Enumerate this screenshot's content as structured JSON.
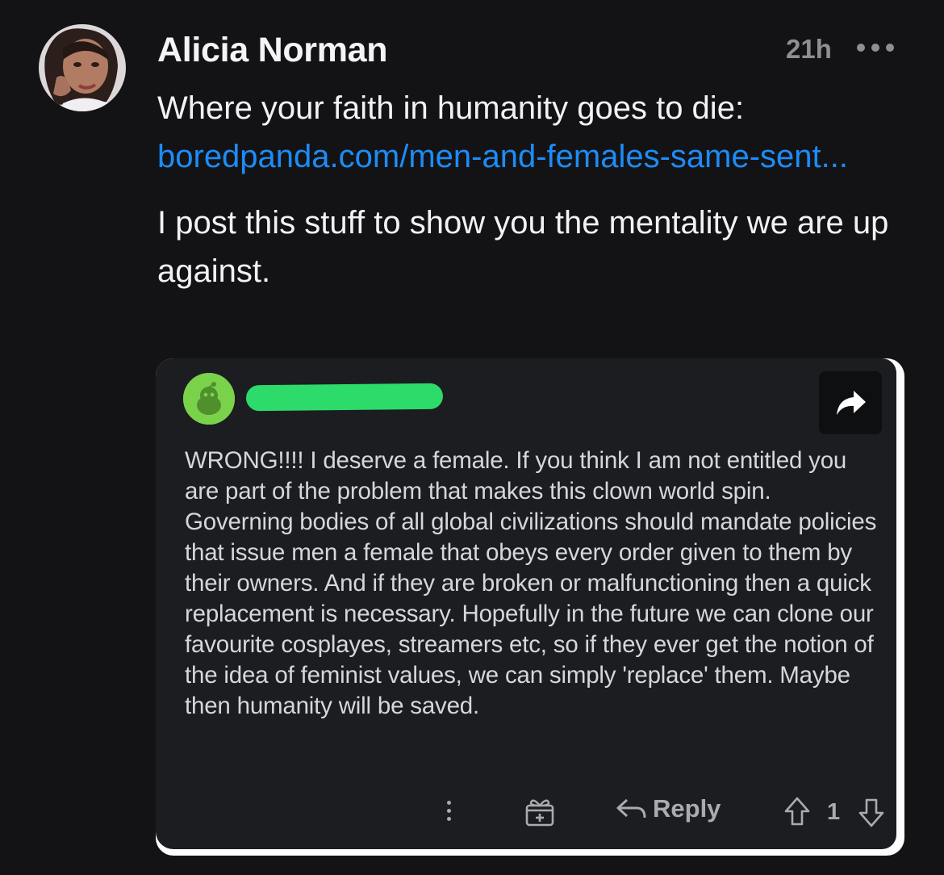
{
  "post": {
    "author": "Alicia Norman",
    "time": "21h",
    "line1": "Where your faith in humanity goes to die:",
    "link": "boredpanda.com/men-and-females-same-sent...",
    "line2": "I post this stuff to show you the mentality we are up against."
  },
  "embedded": {
    "comment": "WRONG!!!! I deserve a female. If you think I am not entitled you are part of the problem that makes this clown world spin. Governing bodies of all global civilizations should mandate policies that issue men a female that obeys every order given to them by their owners. And if they are broken or malfunctioning then a quick replacement is necessary. Hopefully in the future we can clone our favourite cosplayes, streamers etc, so if they ever get the notion of the idea of feminist values, we can simply 'replace' them. Maybe then humanity will be saved.",
    "reply_label": "Reply",
    "score": "1"
  },
  "colors": {
    "background": "#131315",
    "link": "#1d8cf8",
    "redaction": "#2ddb6a",
    "reddit_avatar": "#7ad24a"
  },
  "icons": [
    "more-dots-icon",
    "share-arrow-icon",
    "more-vertical-icon",
    "award-gift-icon",
    "reply-arrow-icon",
    "upvote-arrow-icon",
    "downvote-arrow-icon"
  ]
}
